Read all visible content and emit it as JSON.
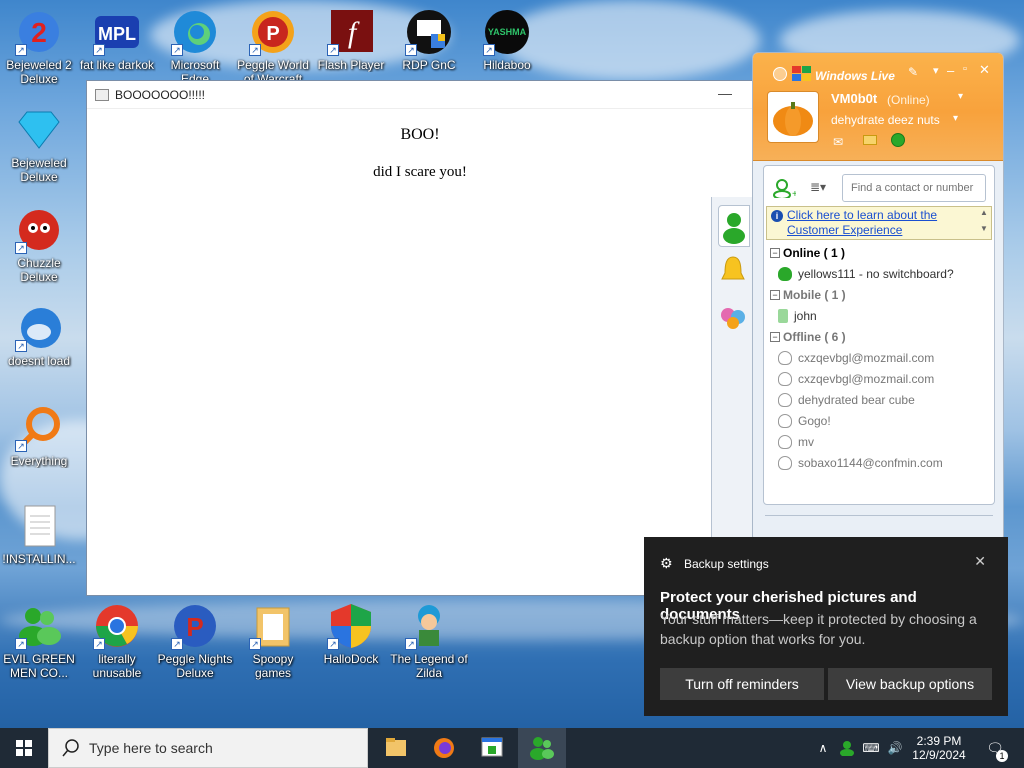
{
  "desktop": {
    "icons": [
      {
        "label": "Bejeweled 2 Deluxe"
      },
      {
        "label": "fat like darkok"
      },
      {
        "label": "Microsoft Edge"
      },
      {
        "label": "Peggle World of Warcraft"
      },
      {
        "label": "Flash Player"
      },
      {
        "label": "RDP GnC"
      },
      {
        "label": "Hildaboo"
      },
      {
        "label": "Bejeweled Deluxe"
      },
      {
        "label": "Chuzzle Deluxe"
      },
      {
        "label": "doesnt load"
      },
      {
        "label": "Everything"
      },
      {
        "label": "!INSTALLIN..."
      },
      {
        "label": "EVIL GREEN MEN CO..."
      },
      {
        "label": "literally unusable"
      },
      {
        "label": "Peggle Nights Deluxe"
      },
      {
        "label": "Spoopy games"
      },
      {
        "label": "HalloDock"
      },
      {
        "label": "The Legend of Zilda"
      }
    ]
  },
  "boo_window": {
    "title": "BOOOOOOO!!!!!",
    "heading": "BOO!",
    "message": "did I scare you!",
    "minimize_glyph": "—"
  },
  "messenger": {
    "brand": "Windows Live",
    "display_name": "VM0b0t",
    "status": "(Online)",
    "personal_message": "dehydrate deez nuts",
    "search_placeholder": "Find a contact or number",
    "info_link": "Click here to learn about the Customer Experience",
    "groups": [
      {
        "name": "Online ( 1 )",
        "contacts": [
          "yellows111 - no switchboard?"
        ]
      },
      {
        "name": "Mobile ( 1 )",
        "contacts": [
          "john"
        ]
      },
      {
        "name": "Offline ( 6 )",
        "contacts": [
          "cxzqevbgl@mozmail.com",
          "cxzqevbgl@mozmail.com",
          "dehydrated bear cube",
          "Gogo!",
          "mv",
          "sobaxo1144@confmin.com"
        ]
      }
    ]
  },
  "toast": {
    "app": "Backup settings",
    "title": "Protect your cherished pictures and documents",
    "body": "Your stuff matters—keep it protected by choosing a backup option that works for you.",
    "button_off": "Turn off reminders",
    "button_view": "View backup options"
  },
  "taskbar": {
    "search_placeholder": "Type here to search",
    "time": "2:39 PM",
    "date": "12/9/2024",
    "notification_count": "1"
  }
}
